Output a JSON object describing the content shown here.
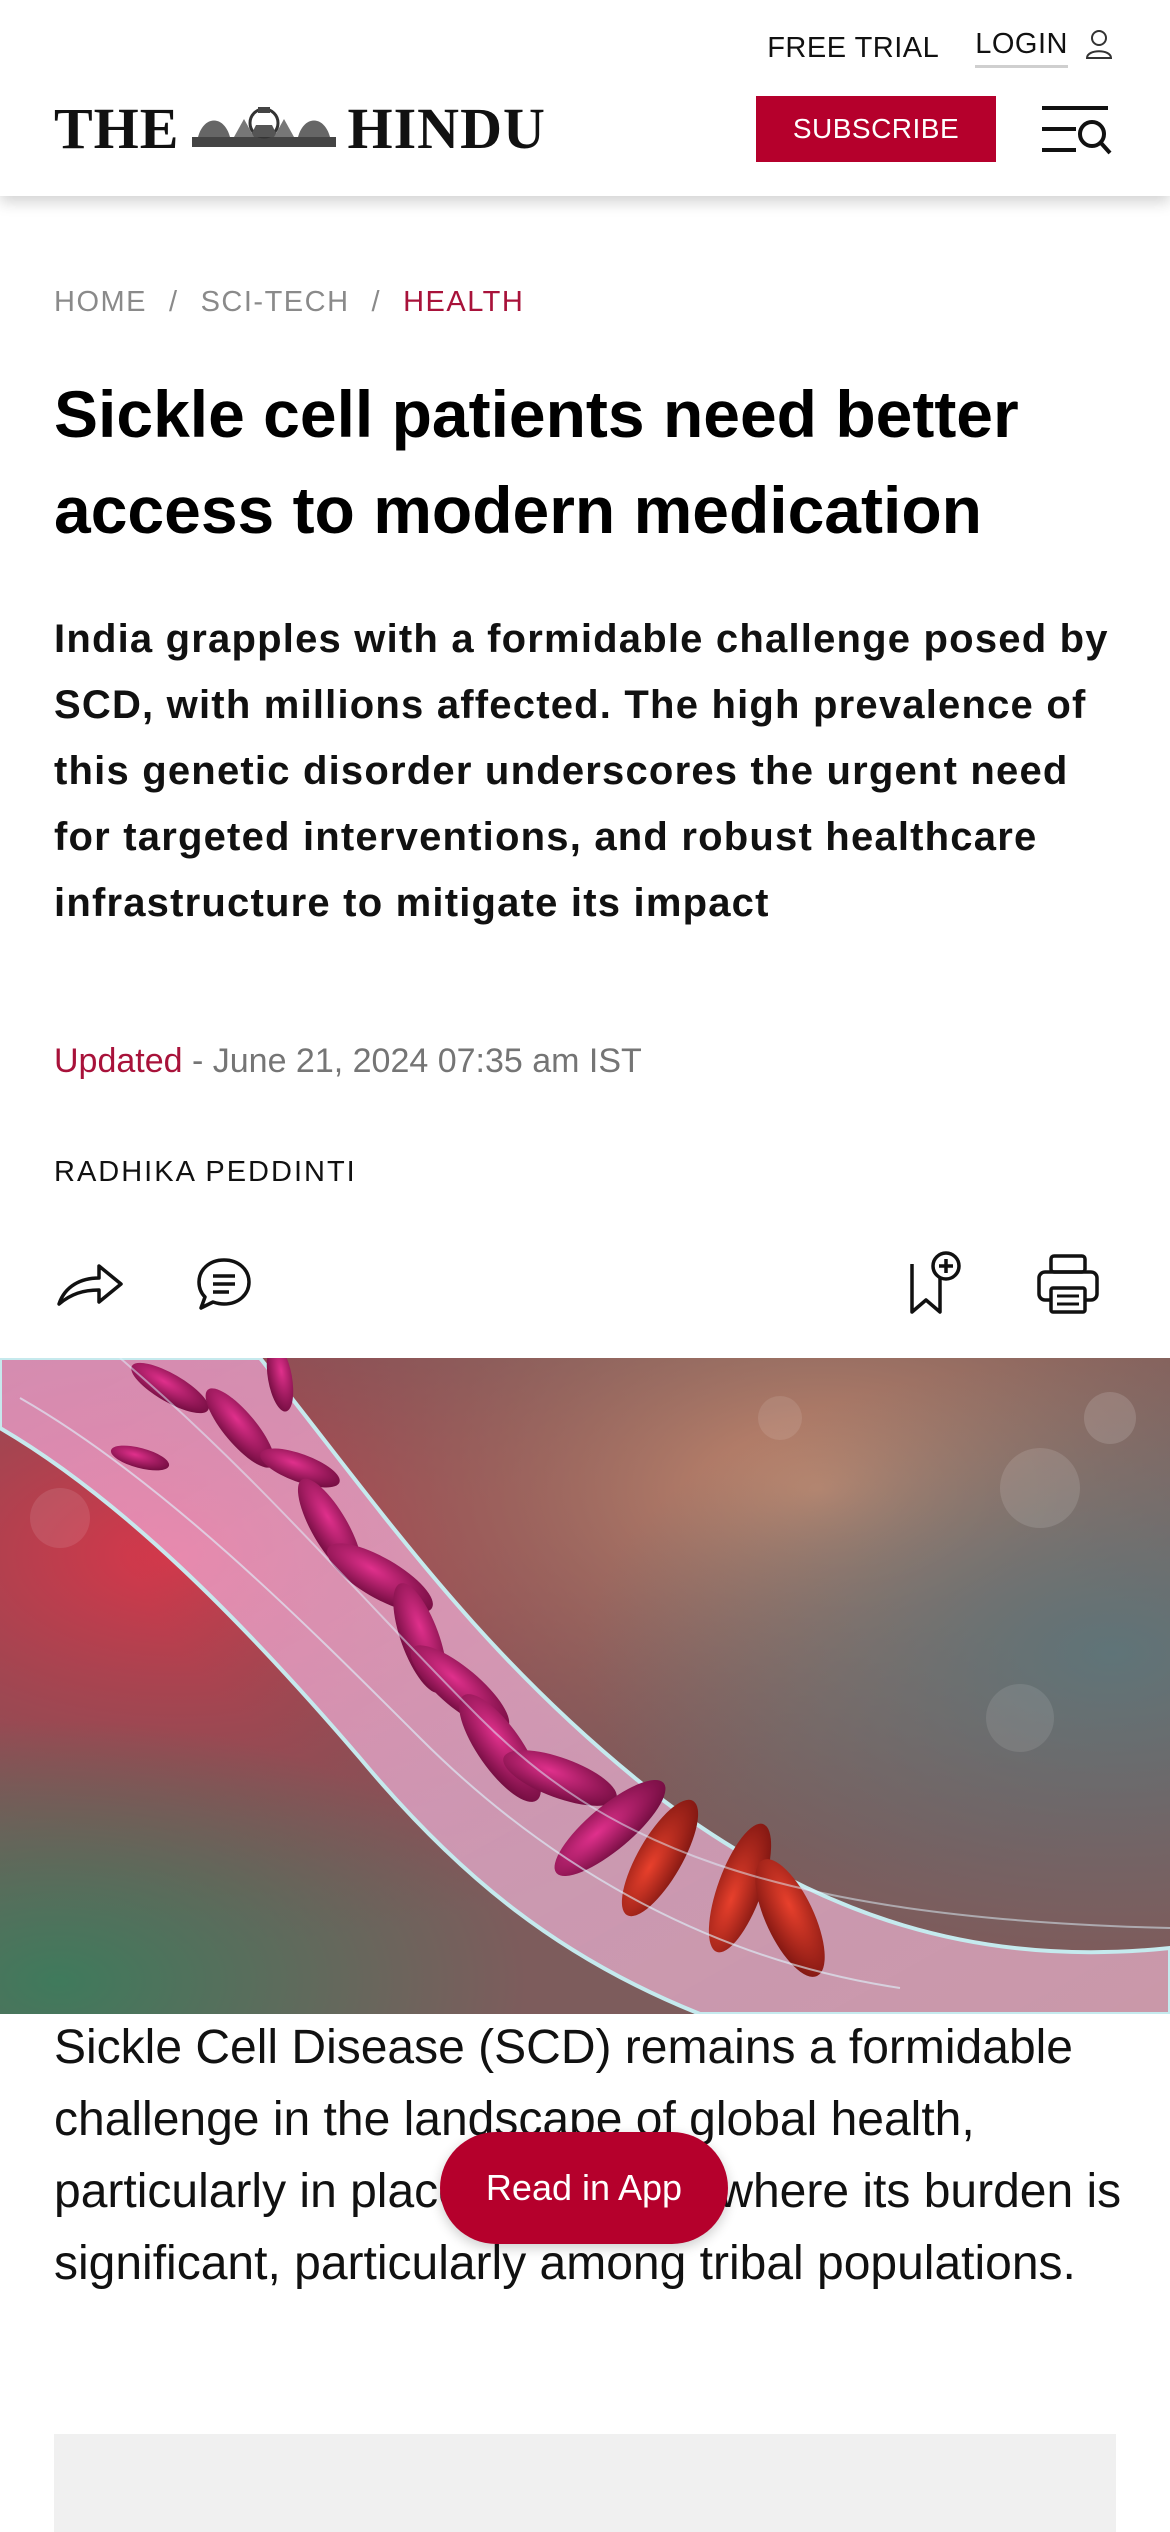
{
  "header": {
    "free_trial": "FREE TRIAL",
    "login": "LOGIN",
    "logo_left": "THE",
    "logo_right": "HINDU",
    "subscribe": "SUBSCRIBE",
    "icons": [
      "user-icon",
      "menu-search-icon"
    ]
  },
  "breadcrumb": {
    "home": "HOME",
    "sep1": "/",
    "section": "SCI-TECH",
    "sep2": "/",
    "current": "HEALTH"
  },
  "article": {
    "title": "Sickle cell patients need better access to modern medication",
    "summary": "India grapples with a formidable challenge posed by SCD, with millions affected. The high prevalence of this genetic disorder underscores the urgent need for targeted interventions, and robust healthcare infrastructure to mitigate its impact",
    "updated_label": "Updated",
    "updated_date": " - June 21, 2024 07:35 am IST",
    "author": "RADHIKA PEDDINTI",
    "action_icons": [
      "share-icon",
      "comment-icon",
      "bookmark-add-icon",
      "print-icon"
    ],
    "body": "Sickle Cell Disease (SCD) remains a formidable challenge in the landscape of global health, particularly in places like India, where its burden is significant, particularly among tribal populations."
  },
  "read_in_app": "Read in App",
  "colors": {
    "brand": "#b5002c",
    "section_accent": "#a8123a",
    "muted": "#8a8a8a"
  }
}
